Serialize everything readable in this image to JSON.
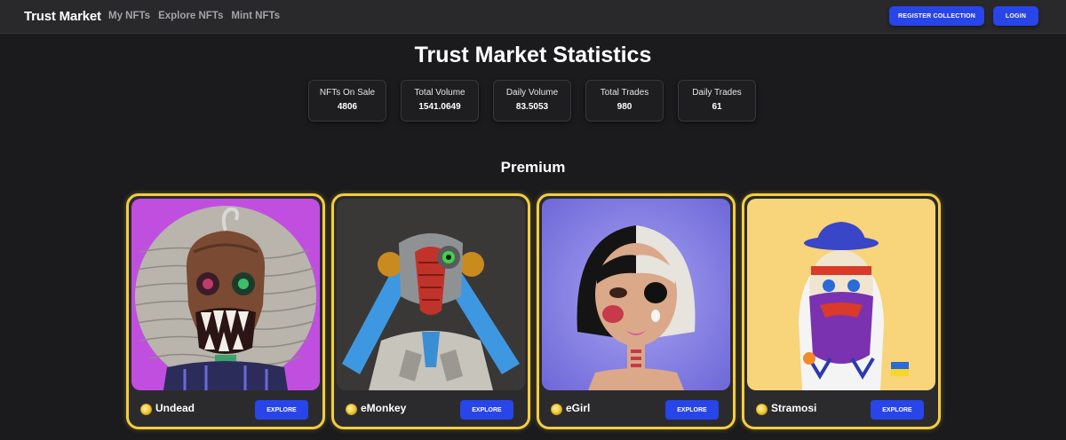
{
  "nav": {
    "brand": "Trust Market",
    "links": [
      "My NFTs",
      "Explore NFTs",
      "Mint NFTs"
    ],
    "register_label": "REGISTER COLLECTION",
    "login_label": "LOGIN"
  },
  "stats": {
    "title": "Trust Market Statistics",
    "items": [
      {
        "label": "NFTs On Sale",
        "value": "4806"
      },
      {
        "label": "Total Volume",
        "value": "1541.0649"
      },
      {
        "label": "Daily Volume",
        "value": "83.5053"
      },
      {
        "label": "Total Trades",
        "value": "980"
      },
      {
        "label": "Daily Trades",
        "value": "61"
      }
    ]
  },
  "premium": {
    "title": "Premium",
    "cards": [
      {
        "name": "Undead",
        "button": "EXPLORE",
        "art_bg": "#c04fe0"
      },
      {
        "name": "eMonkey",
        "button": "EXPLORE",
        "art_bg": "#3a3836"
      },
      {
        "name": "eGirl",
        "button": "EXPLORE",
        "art_bg": "#8a86e6"
      },
      {
        "name": "Stramosi",
        "button": "EXPLORE",
        "art_bg": "#f8d47a"
      }
    ]
  },
  "colors": {
    "accent": "#2745e8",
    "gold": "#f4cd3f",
    "background": "#1b1b1d",
    "navbar": "#29292c"
  }
}
